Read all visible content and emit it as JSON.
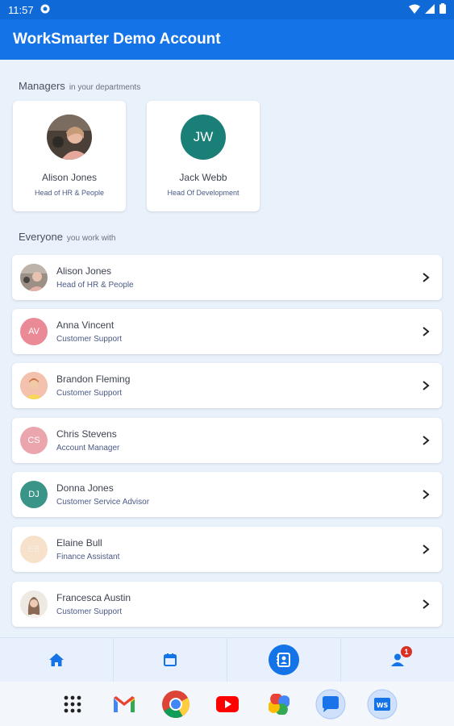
{
  "status_bar": {
    "time": "11:57"
  },
  "app_bar": {
    "title": "WorkSmarter Demo Account"
  },
  "managers": {
    "label": "Managers",
    "sublabel": "in your departments",
    "items": [
      {
        "name": "Alison Jones",
        "title": "Head of HR & People",
        "avatar": "photo"
      },
      {
        "name": "Jack Webb",
        "title": "Head Of Development",
        "initials": "JW",
        "color": "#1a7f77"
      }
    ]
  },
  "everyone": {
    "label": "Everyone",
    "sublabel": "you work with",
    "items": [
      {
        "name": "Alison Jones",
        "role": "Head of HR & People",
        "avatar": "photo"
      },
      {
        "name": "Anna Vincent",
        "role": "Customer Support",
        "initials": "AV",
        "color": "#ea8a97"
      },
      {
        "name": "Brandon Fleming",
        "role": "Customer Support",
        "avatar": "photo"
      },
      {
        "name": "Chris Stevens",
        "role": "Account Manager",
        "initials": "CS",
        "color": "#eaa5ad"
      },
      {
        "name": "Donna Jones",
        "role": "Customer Service Advisor",
        "initials": "DJ",
        "color": "#3a9488"
      },
      {
        "name": "Elaine Bull",
        "role": "Finance Assistant",
        "initials": "EB",
        "color": "#f8e1cb"
      },
      {
        "name": "Francesca Austin",
        "role": "Customer Support",
        "avatar": "photo"
      }
    ]
  },
  "bottom_nav": {
    "items": [
      "home-icon",
      "calendar-icon",
      "directory-icon",
      "profile-icon"
    ],
    "active": "directory-icon",
    "badge_count": "1"
  },
  "taskbar": {
    "apps": [
      "apps-grid-icon",
      "gmail-icon",
      "chrome-icon",
      "youtube-icon",
      "photos-icon",
      "messages-icon",
      "worksmarter-icon"
    ],
    "ws_label": "WS"
  },
  "colors": {
    "primary": "#1473e6",
    "status_bar": "#0f6ad8",
    "background": "#e9f1fb",
    "badge": "#d93025"
  }
}
